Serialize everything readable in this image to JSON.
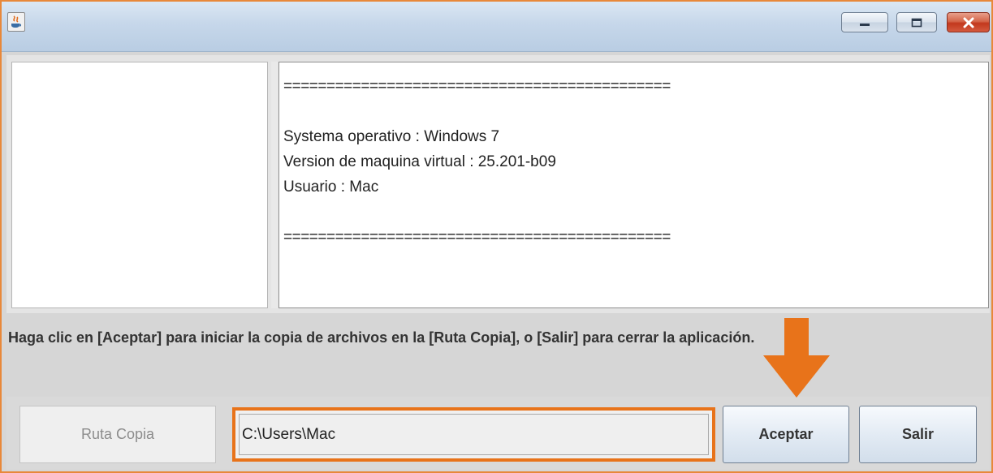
{
  "window": {
    "title": "",
    "controls": {
      "minimize_icon": "minimize-icon",
      "maximize_icon": "maximize-icon",
      "close_icon": "close-icon"
    }
  },
  "info_panel": {
    "separator_top": "=============================================",
    "os_line": "Systema operativo : Windows 7",
    "vm_line": "Version de maquina virtual : 25.201-b09",
    "user_line": "Usuario : Mac",
    "separator_bottom": "============================================="
  },
  "message": "Haga clic en [Aceptar] para iniciar la copia de archivos en la [Ruta Copia], o [Salir] para cerrar la aplicación.",
  "bottom": {
    "ruta_copia_label": "Ruta Copia",
    "path_value": "C:\\Users\\Mac",
    "aceptar_label": "Aceptar",
    "salir_label": "Salir"
  },
  "annotations": {
    "highlight_color": "#e8731a",
    "arrow_color": "#e8731a"
  }
}
